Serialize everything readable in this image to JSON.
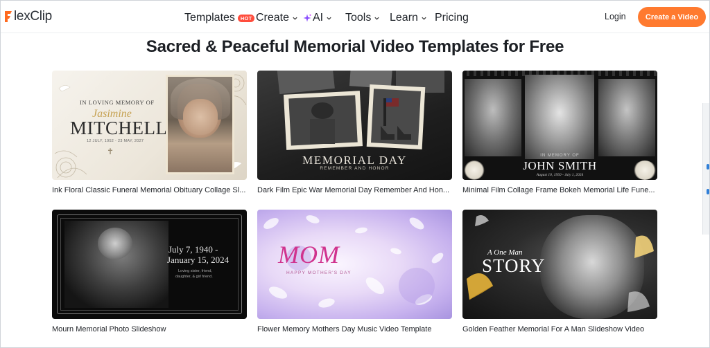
{
  "header": {
    "logo_text": "lexClip",
    "nav": [
      {
        "label": "Templates",
        "badge": "HOT"
      },
      {
        "label": "Create"
      },
      {
        "label": "AI"
      },
      {
        "label": "Tools"
      },
      {
        "label": "Learn"
      },
      {
        "label": "Pricing"
      }
    ],
    "login_label": "Login",
    "cta_label": "Create a Video"
  },
  "page": {
    "title": "Sacred & Peaceful Memorial Video Templates for Free"
  },
  "templates": [
    {
      "caption": "Ink Floral Classic Funeral Memorial Obituary Collage Sl...",
      "thumb": {
        "line1": "IN LOVING MEMORY OF",
        "script": "Jasimine",
        "name": "MITCHELL",
        "dates": "12 JULY, 1952 - 23 MAY, 2027"
      }
    },
    {
      "caption": "Dark Film Epic War Memorial Day Remember And Hon...",
      "thumb": {
        "title": "MEMORIAL DAY",
        "subtitle": "REMEMBER AND HONOR"
      }
    },
    {
      "caption": "Minimal Film Collage Frame Bokeh Memorial Life Fune...",
      "thumb": {
        "line1": "IN MEMORY OF",
        "name": "JOHN SMITH",
        "dates": "August 10, 1950 - July 1, 2024"
      }
    },
    {
      "caption": "Mourn Memorial Photo Slideshow",
      "thumb": {
        "date1": "July 7, 1940 -",
        "date2": "January 15, 2024",
        "note1": "Loving sister, friend,",
        "note2": "daughter, & girl friend."
      }
    },
    {
      "caption": "Flower Memory Mothers Day Music Video Template",
      "thumb": {
        "title": "MOM",
        "subtitle": "HAPPY MOTHER'S DAY"
      }
    },
    {
      "caption": "Golden Feather Memorial For A Man Slideshow Video",
      "thumb": {
        "script": "A One Man",
        "title": "STORY"
      }
    }
  ],
  "colors": {
    "brand_orange": "#ff7a2f",
    "hot_badge": "#ff4d3d",
    "text": "#1f2329"
  }
}
